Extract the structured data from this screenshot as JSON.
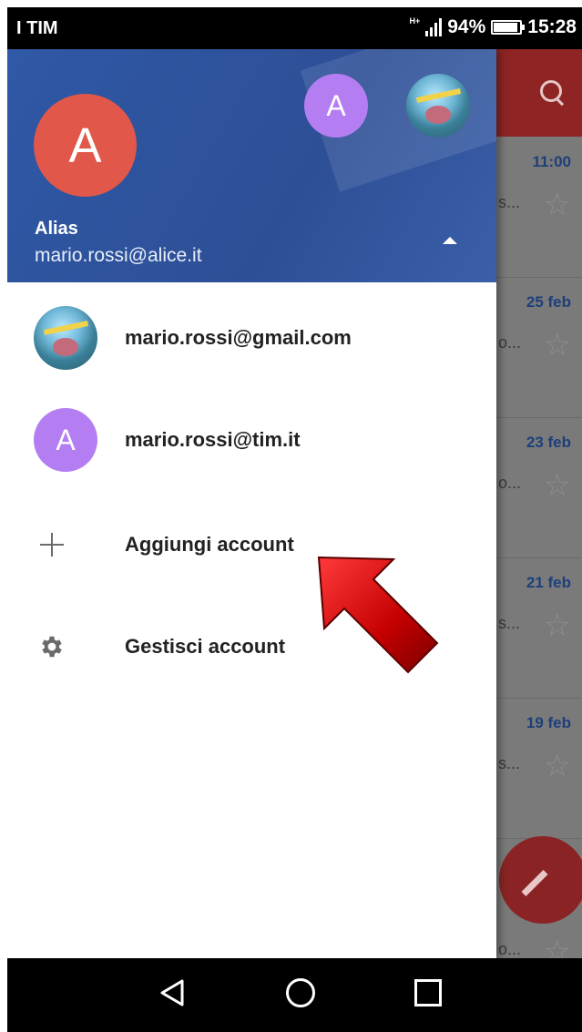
{
  "status_bar": {
    "carrier": "I TIM",
    "network": "H+",
    "battery_percent": "94%",
    "battery_level": 0.94,
    "time": "15:28"
  },
  "drawer": {
    "current_account": {
      "avatar_letter": "A",
      "name": "Alias",
      "email": "mario.rossi@alice.it",
      "avatar_color": "#e1574a"
    },
    "header_avatars": [
      {
        "type": "letter",
        "letter": "A",
        "color": "#b47ef2"
      },
      {
        "type": "photo"
      }
    ],
    "items": [
      {
        "kind": "account",
        "avatar": "photo",
        "label": "mario.rossi@gmail.com"
      },
      {
        "kind": "account",
        "avatar": "letter",
        "avatar_letter": "A",
        "avatar_color": "#b47ef2",
        "label": "mario.rossi@tim.it"
      },
      {
        "kind": "action",
        "icon": "plus-icon",
        "label": "Aggiungi account"
      },
      {
        "kind": "action",
        "icon": "gear-icon",
        "label": "Gestisci account"
      }
    ],
    "header_color": "#2f58a6"
  },
  "background_list": {
    "rows": [
      {
        "date": "11:00",
        "snippet": "s..."
      },
      {
        "date": "25 feb",
        "snippet": "o..."
      },
      {
        "date": "23 feb",
        "snippet": "o..."
      },
      {
        "date": "21 feb",
        "snippet": "s..."
      },
      {
        "date": "19 feb",
        "snippet": "s..."
      },
      {
        "date": "",
        "snippet": "o..."
      }
    ],
    "toolbar_color": "#8e2424"
  }
}
